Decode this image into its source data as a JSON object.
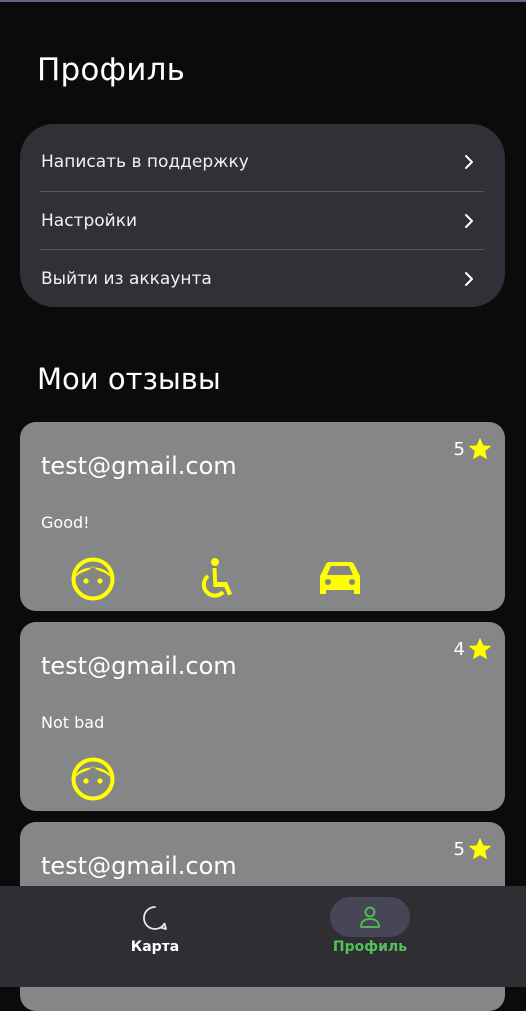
{
  "profile": {
    "title": "Профиль"
  },
  "menu": {
    "items": [
      {
        "label": "Написать в поддержку"
      },
      {
        "label": "Настройки"
      },
      {
        "label": "Выйти из аккаунта"
      }
    ]
  },
  "reviews": {
    "title": "Мои отзывы",
    "items": [
      {
        "email": "test@gmail.com",
        "text": "Good!",
        "rating": "5",
        "icons": [
          "child-face-icon",
          "wheelchair-icon",
          "car-icon"
        ]
      },
      {
        "email": "test@gmail.com",
        "text": "Not bad",
        "rating": "4",
        "icons": [
          "child-face-icon"
        ]
      },
      {
        "email": "test@gmail.com",
        "text": "",
        "rating": "5",
        "icons": []
      }
    ]
  },
  "nav": {
    "items": [
      {
        "label": "Карта",
        "icon": "chat-bubble-icon",
        "active": false
      },
      {
        "label": "Профиль",
        "icon": "user-icon",
        "active": true
      }
    ]
  },
  "colors": {
    "background": "#0b0b0b",
    "menu_card": "#303036",
    "review_card": "#858687",
    "accent_yellow": "#ffff00",
    "active_green": "#52c15a",
    "nav_bar": "#2e2e33"
  }
}
